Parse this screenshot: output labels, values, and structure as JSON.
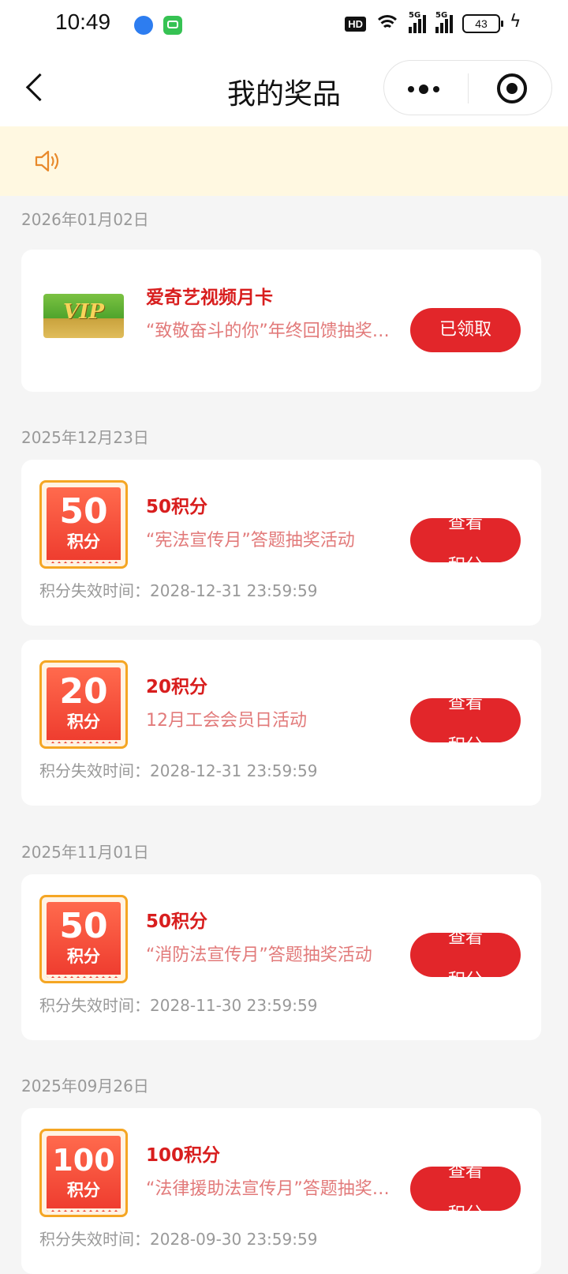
{
  "status_bar": {
    "time": "10:49",
    "hd_label": "HD",
    "network_1": "5G",
    "network_2": "5G",
    "battery": "43"
  },
  "nav": {
    "title": "我的奖品"
  },
  "icons": {
    "back": "chevron-left-icon",
    "more": "more-dots-icon",
    "close": "target-icon",
    "notice": "speaker-icon"
  },
  "colors": {
    "accent": "#e2262a",
    "prize_name": "#d81e1e",
    "notice_bg": "#fff8e1",
    "badge_border": "#f5a623"
  },
  "groups": [
    {
      "date": "2026年01月02日",
      "items": [
        {
          "type": "vip",
          "image_text": "VIP",
          "name": "爱奇艺视频月卡",
          "desc": "“致敬奋斗的你”年终回馈抽奖活动",
          "button": "已领取"
        }
      ]
    },
    {
      "date": "2025年12月23日",
      "items": [
        {
          "type": "points",
          "badge_value": "50",
          "badge_unit": "积分",
          "name": "50积分",
          "desc": "“宪法宣传月”答题抽奖活动",
          "expire_label": "积分失效时间：",
          "expire_time": "2028-12-31 23:59:59",
          "button": "查看积分"
        },
        {
          "type": "points",
          "badge_value": "20",
          "badge_unit": "积分",
          "name": "20积分",
          "desc": "12月工会会员日活动",
          "expire_label": "积分失效时间：",
          "expire_time": "2028-12-31 23:59:59",
          "button": "查看积分"
        }
      ]
    },
    {
      "date": "2025年11月01日",
      "items": [
        {
          "type": "points",
          "badge_value": "50",
          "badge_unit": "积分",
          "name": "50积分",
          "desc": "“消防法宣传月”答题抽奖活动",
          "expire_label": "积分失效时间：",
          "expire_time": "2028-11-30 23:59:59",
          "button": "查看积分"
        }
      ]
    },
    {
      "date": "2025年09月26日",
      "items": [
        {
          "type": "points",
          "badge_value": "100",
          "badge_unit": "积分",
          "name": "100积分",
          "desc": "“法律援助法宣传月”答题抽奖活动",
          "expire_label": "积分失效时间：",
          "expire_time": "2028-09-30 23:59:59",
          "button": "查看积分"
        }
      ]
    }
  ]
}
